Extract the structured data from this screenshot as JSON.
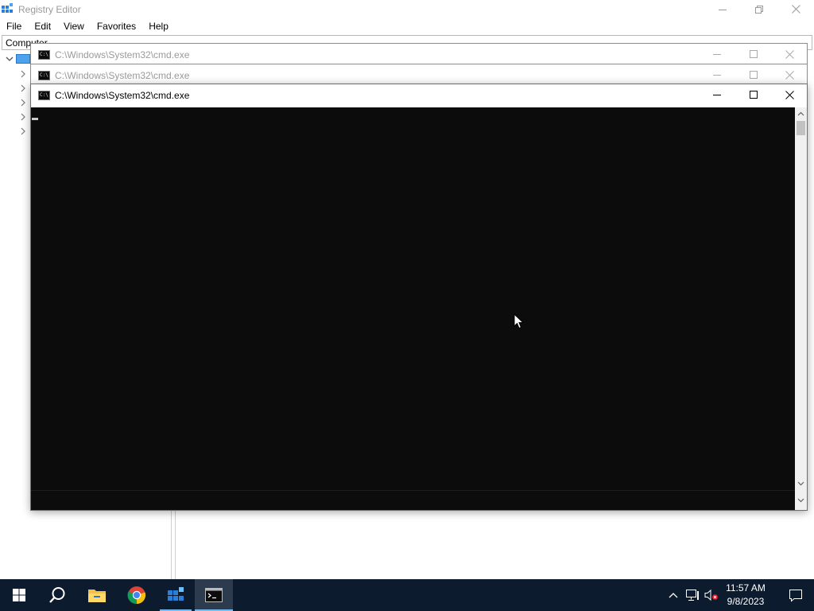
{
  "registry_editor": {
    "title": "Registry Editor",
    "menu": [
      "File",
      "Edit",
      "View",
      "Favorites",
      "Help"
    ],
    "address": "Computer"
  },
  "cmd_windows": [
    {
      "title": "C:\\Windows\\System32\\cmd.exe",
      "state": "inactive"
    },
    {
      "title": "C:\\Windows\\System32\\cmd.exe",
      "state": "inactive"
    },
    {
      "title": "C:\\Windows\\System32\\cmd.exe",
      "state": "active"
    }
  ],
  "cmd_icon_text": "C:\\",
  "taskbar": {
    "apps": [
      "start-icon",
      "search-icon",
      "file-explorer-icon",
      "chrome-icon",
      "registry-editor-icon",
      "cmd-icon"
    ],
    "clock": {
      "time": "11:57 AM",
      "date": "9/8/2023"
    }
  },
  "colors": {
    "console_bg": "#0c0c0c",
    "taskbar_bg": "#0d1b2e",
    "taskbar_accent": "#76b9ed"
  }
}
